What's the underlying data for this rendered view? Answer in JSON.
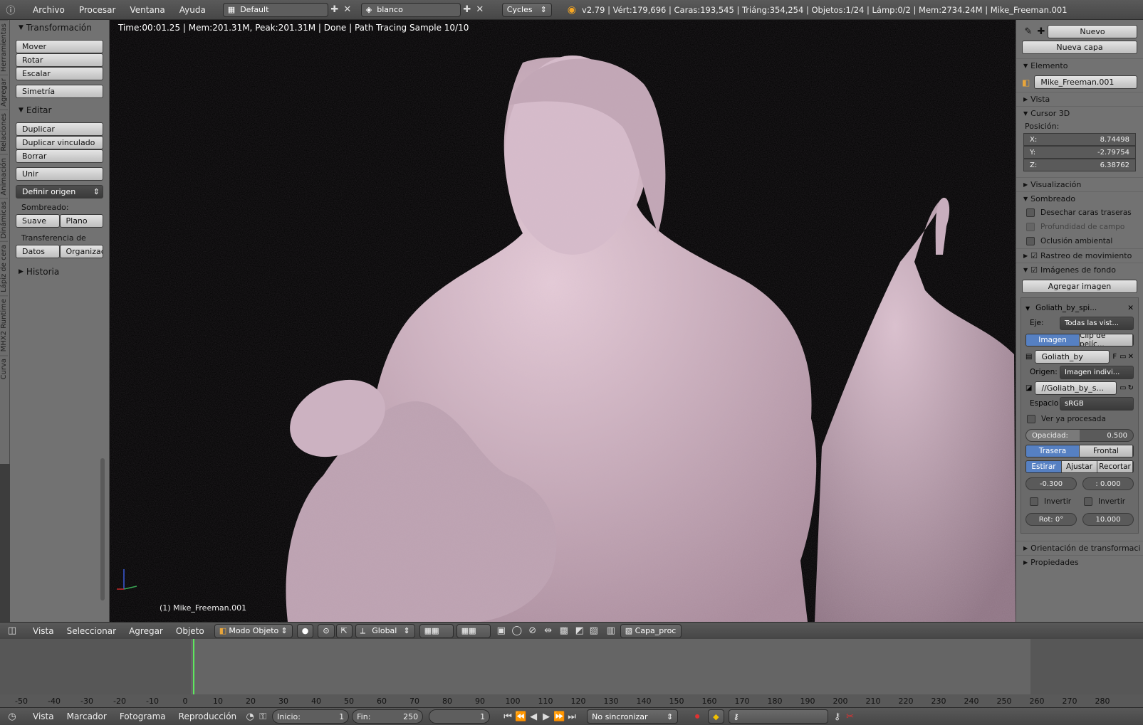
{
  "topbar": {
    "menus": [
      "Archivo",
      "Procesar",
      "Ventana",
      "Ayuda"
    ],
    "layout": "Default",
    "scene": "blanco",
    "engine": "Cycles",
    "stats": "v2.79 | Vért:179,696 | Caras:193,545 | Triáng:354,254 | Objetos:1/24 | Lámp:0/2 | Mem:2734.24M | Mike_Freeman.001"
  },
  "lefttabs": [
    "Herramientas",
    "Agregar",
    "Relaciones",
    "Animación",
    "Dinámicas",
    "Lápiz de cera",
    "MHX2 Runtime",
    "Curva"
  ],
  "toolshelf": {
    "transform_title": "Transformación",
    "move": "Mover",
    "rotate": "Rotar",
    "scale": "Escalar",
    "mirror": "Simetría",
    "edit_title": "Editar",
    "duplicate": "Duplicar",
    "duplicate_linked": "Duplicar vinculado",
    "delete": "Borrar",
    "join": "Unir",
    "set_origin": "Definir origen",
    "shading_label": "Sombreado:",
    "smooth": "Suave",
    "flat": "Plano",
    "data_transfer_label": "Transferencia de datos:",
    "data": "Datos",
    "organize": "Organizaci",
    "history_title": "Historia"
  },
  "viewport": {
    "render_info": "Time:00:01.25 | Mem:201.31M, Peak:201.31M | Done | Path Tracing Sample 10/10",
    "object_label": "(1) Mike_Freeman.001"
  },
  "props": {
    "new_btn": "Nuevo",
    "new_layer": "Nueva capa",
    "item_title": "Elemento",
    "item_name": "Mike_Freeman.001",
    "view_title": "Vista",
    "cursor_title": "Cursor 3D",
    "position_label": "Posición:",
    "x_label": "X:",
    "x_val": "8.74498",
    "y_label": "Y:",
    "y_val": "-2.79754",
    "z_label": "Z:",
    "z_val": "6.38762",
    "display_title": "Visualización",
    "shading_title": "Sombreado",
    "backface": "Desechar caras traseras",
    "dof": "Profundidad de campo",
    "ao": "Oclusión ambiental",
    "motion_tracking": "Rastreo de movimiento",
    "bg_images": "Imágenes de fondo",
    "add_image": "Agregar imagen",
    "img_name": "Goliath_by_spi...",
    "axis_label": "Eje:",
    "axis_val": "Todas las vist...",
    "tab_image": "Imagen",
    "tab_clip": "Clip de pelíc...",
    "img_file": "Goliath_by",
    "img_file_f": "F",
    "source_label": "Origen:",
    "source_val": "Imagen indivi...",
    "path": "//Goliath_by_s...",
    "space_label": "Espacio",
    "space_val": "sRGB",
    "view_processed": "Ver ya procesada",
    "opacity_label": "Opacidad:",
    "opacity_val": "0.500",
    "back": "Trasera",
    "front": "Frontal",
    "stretch": "Estirar",
    "fit": "Ajustar",
    "crop": "Recortar",
    "offset_x": "-0.300",
    "offset_y": ": 0.000",
    "invert1": "Invertir",
    "invert2": "Invertir",
    "rot": "Rot: 0°",
    "size": "10.000",
    "orientation_title": "Orientación de transformaci",
    "properties_title": "Propiedades"
  },
  "header3d": {
    "view": "Vista",
    "select": "Seleccionar",
    "add": "Agregar",
    "object": "Objeto",
    "mode": "Modo Objeto",
    "orientation": "Global",
    "render_layer": "Capa_proc"
  },
  "timeline": {
    "ticks": [
      "-50",
      "-40",
      "-30",
      "-20",
      "-10",
      "0",
      "10",
      "20",
      "30",
      "40",
      "50",
      "60",
      "70",
      "80",
      "90",
      "100",
      "110",
      "120",
      "130",
      "140",
      "150",
      "160",
      "170",
      "180",
      "190",
      "200",
      "210",
      "220",
      "230",
      "240",
      "250",
      "260",
      "270",
      "280"
    ]
  },
  "footer": {
    "view": "Vista",
    "marker": "Marcador",
    "frame": "Fotograma",
    "playback": "Reproducción",
    "start_label": "Inicio:",
    "start_val": "1",
    "end_label": "Fin:",
    "end_val": "250",
    "current": "1",
    "sync": "No sincronizar"
  }
}
